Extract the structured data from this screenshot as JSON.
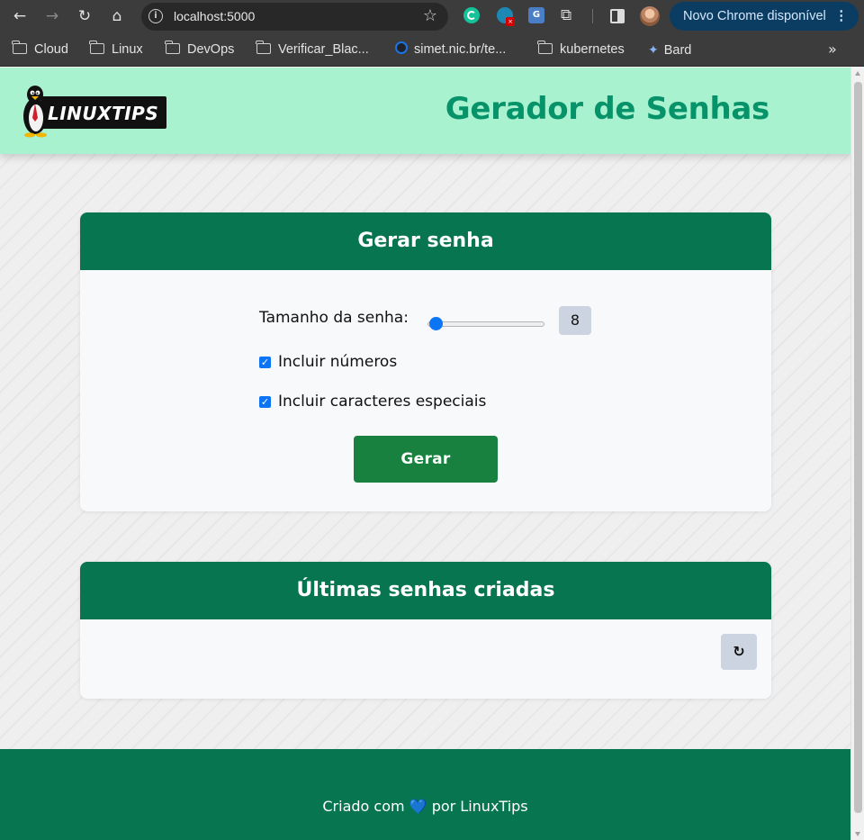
{
  "browser": {
    "address": "localhost:5000",
    "update_label": "Novo Chrome disponível",
    "bookmarks": [
      "Cloud",
      "Linux",
      "DevOps",
      "Verificar_Blac...",
      "simet.nic.br/te...",
      "kubernetes",
      "Bard"
    ]
  },
  "header": {
    "logo_text": "LINUXTIPS",
    "title": "Gerador de Senhas"
  },
  "generator": {
    "title": "Gerar senha",
    "length_label": "Tamanho da senha:",
    "length_value": "8",
    "include_numbers_label": "Incluir números",
    "include_special_label": "Incluir caracteres especiais",
    "button_label": "Gerar"
  },
  "history": {
    "title": "Últimas senhas criadas",
    "refresh_glyph": "↻"
  },
  "footer": {
    "prefix": "Criado com",
    "suffix": "por LinuxTips"
  },
  "colors": {
    "header_bg": "#a8f2d0",
    "title": "#079369",
    "card_head": "#077550",
    "button": "#18813f",
    "accent": "#0b75f5"
  }
}
